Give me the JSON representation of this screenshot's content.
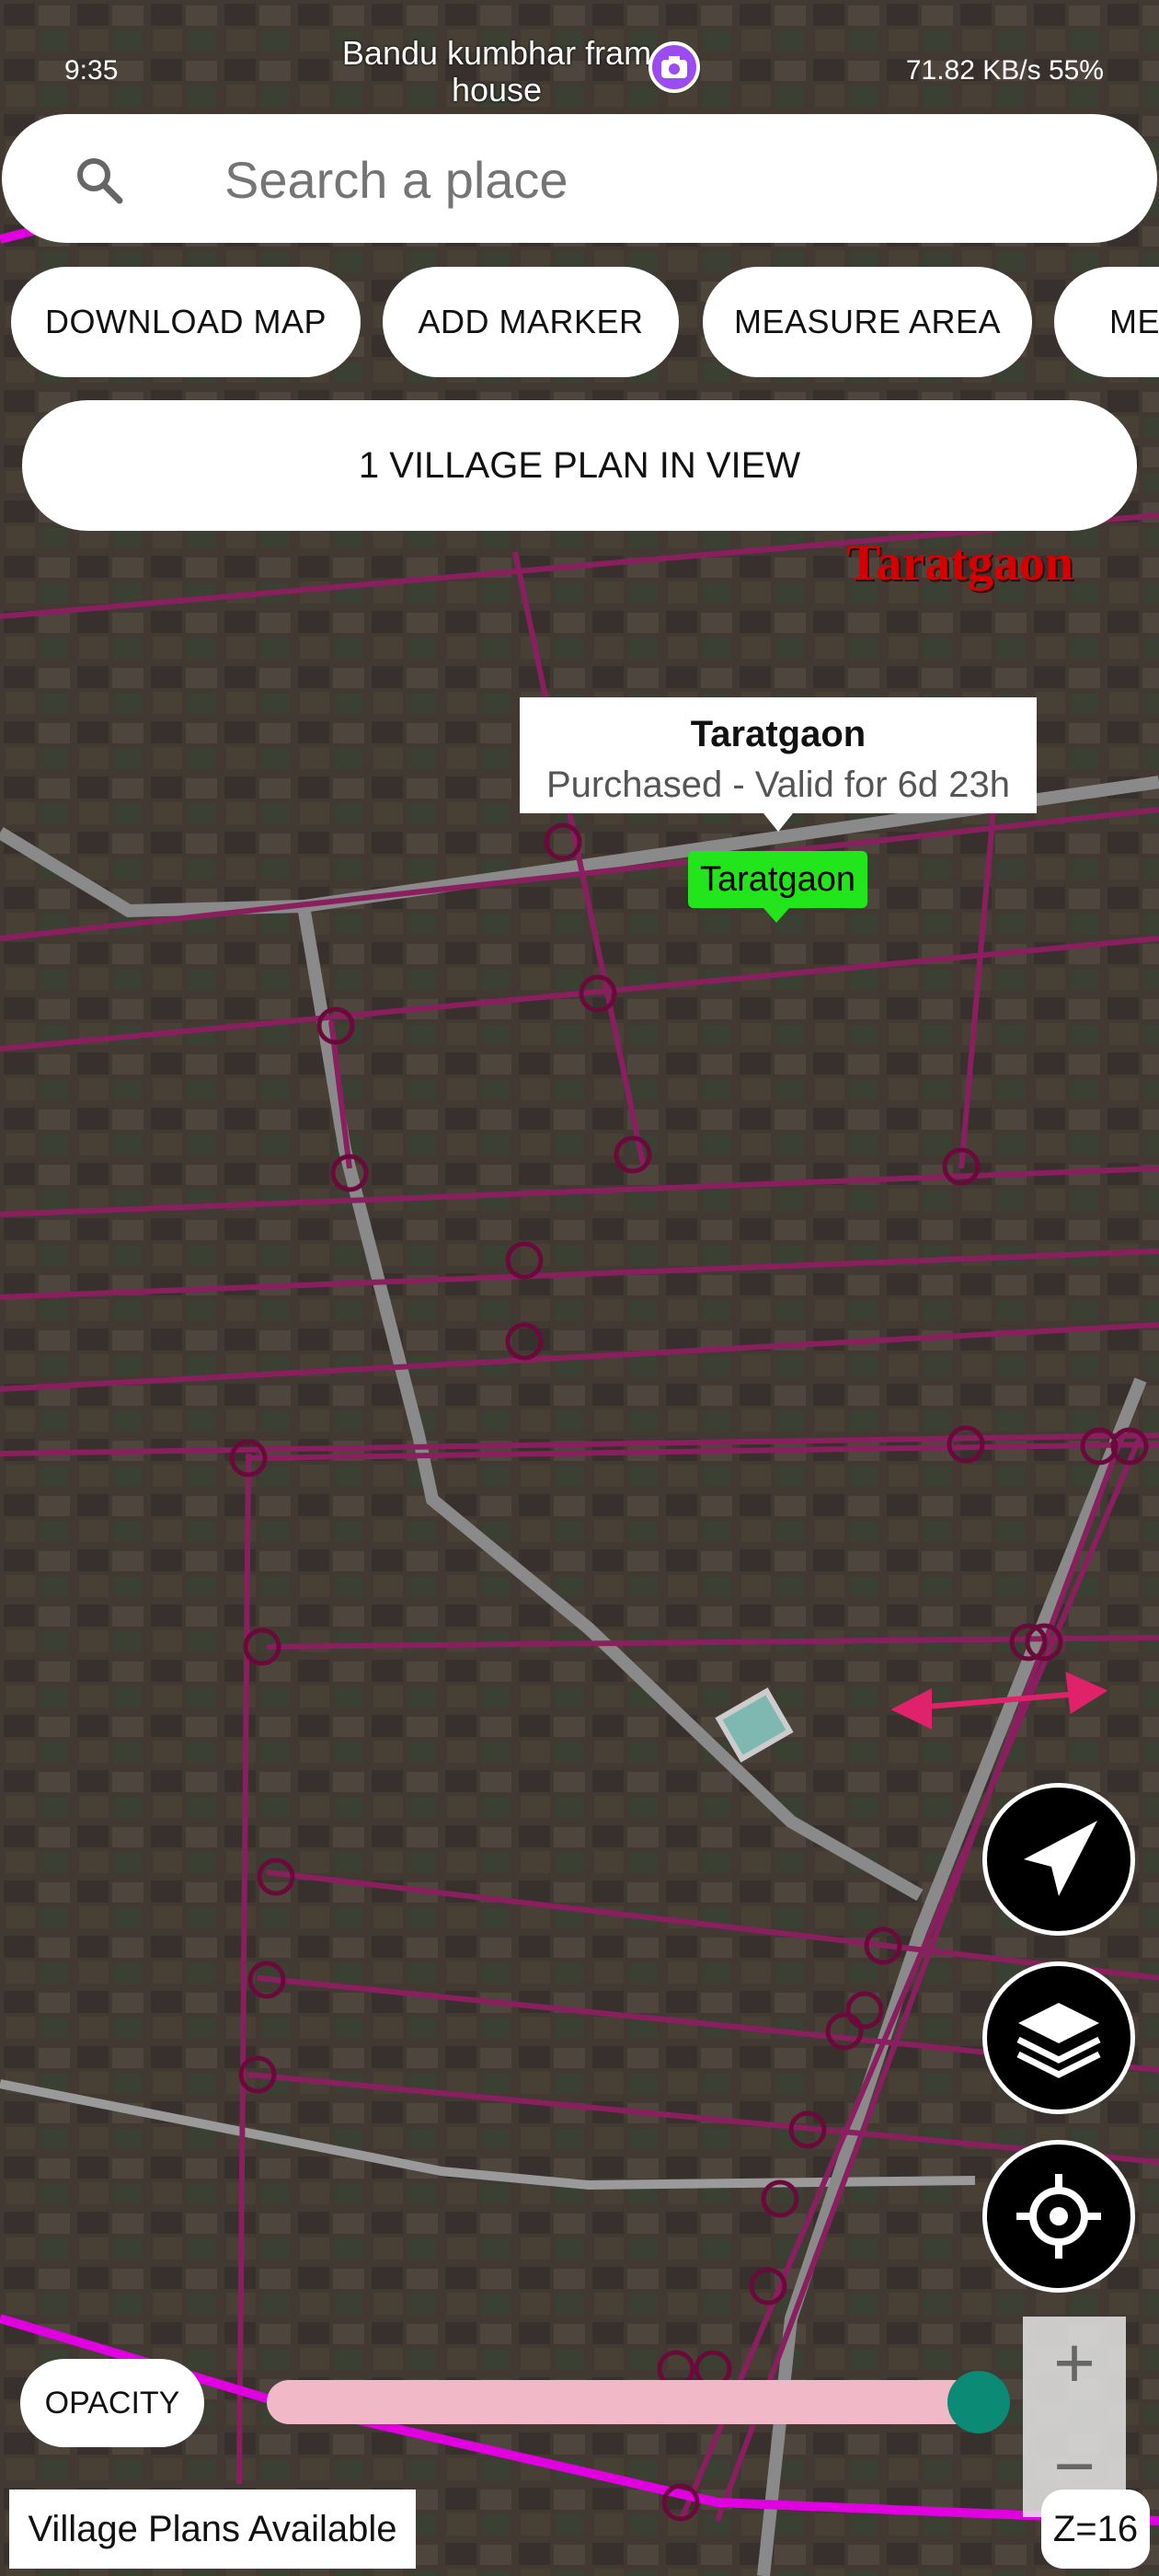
{
  "status_bar": {
    "time": "9:35",
    "right_text": "71.82 KB/s  55%"
  },
  "poi_label": "Bandu kumbhar fram house",
  "search": {
    "placeholder": "Search a place"
  },
  "chips": [
    "DOWNLOAD MAP",
    "ADD MARKER",
    "MEASURE AREA",
    "MEA"
  ],
  "village_plans_button": "1 VILLAGE PLAN IN VIEW",
  "map_labels": {
    "village_name_red": "Taratgaon"
  },
  "callout": {
    "title": "Taratgaon",
    "subtitle": "Purchased - Valid for 6d 23h"
  },
  "green_marker_label": "Taratgaon",
  "controls": {
    "opacity_label": "OPACITY",
    "opacity_value": 0.97,
    "zoom_in": "+",
    "zoom_out": "−",
    "zoom_level": "Z=16",
    "footer_label": "Village Plans Available"
  },
  "icons": [
    "search-icon",
    "camera-icon",
    "navigation-arrow-icon",
    "layers-icon",
    "my-location-icon"
  ],
  "colors": {
    "accent": "#0b8a76",
    "slider_track": "#f1b8c8",
    "boundary": "#cc00cc",
    "marker_green": "#22e51b"
  }
}
